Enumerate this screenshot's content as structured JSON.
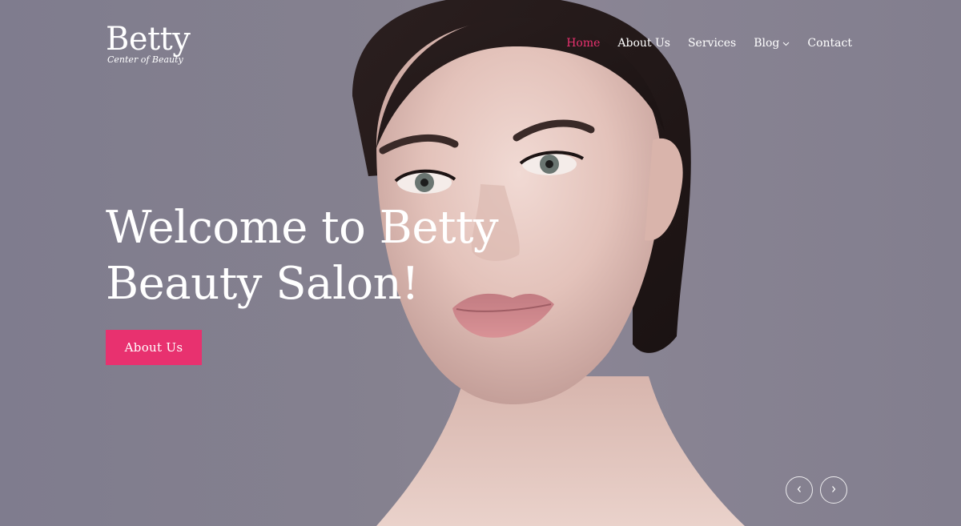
{
  "logo": {
    "name": "Betty",
    "tagline": "Center of Beauty"
  },
  "nav": {
    "items": [
      {
        "label": "Home",
        "active": true
      },
      {
        "label": "About Us",
        "active": false
      },
      {
        "label": "Services",
        "active": false
      },
      {
        "label": "Blog",
        "active": false,
        "has_dropdown": true
      },
      {
        "label": "Contact",
        "active": false
      }
    ]
  },
  "hero": {
    "headline_line1": "Welcome to Betty",
    "headline_line2": "Beauty Salon!",
    "cta_label": "About Us",
    "background_image": "woman-portrait"
  },
  "slider": {
    "prev_icon": "chevron-left-icon",
    "next_icon": "chevron-right-icon"
  },
  "colors": {
    "accent": "#e8316f",
    "background": "#7e7a8b",
    "text": "#ffffff"
  }
}
